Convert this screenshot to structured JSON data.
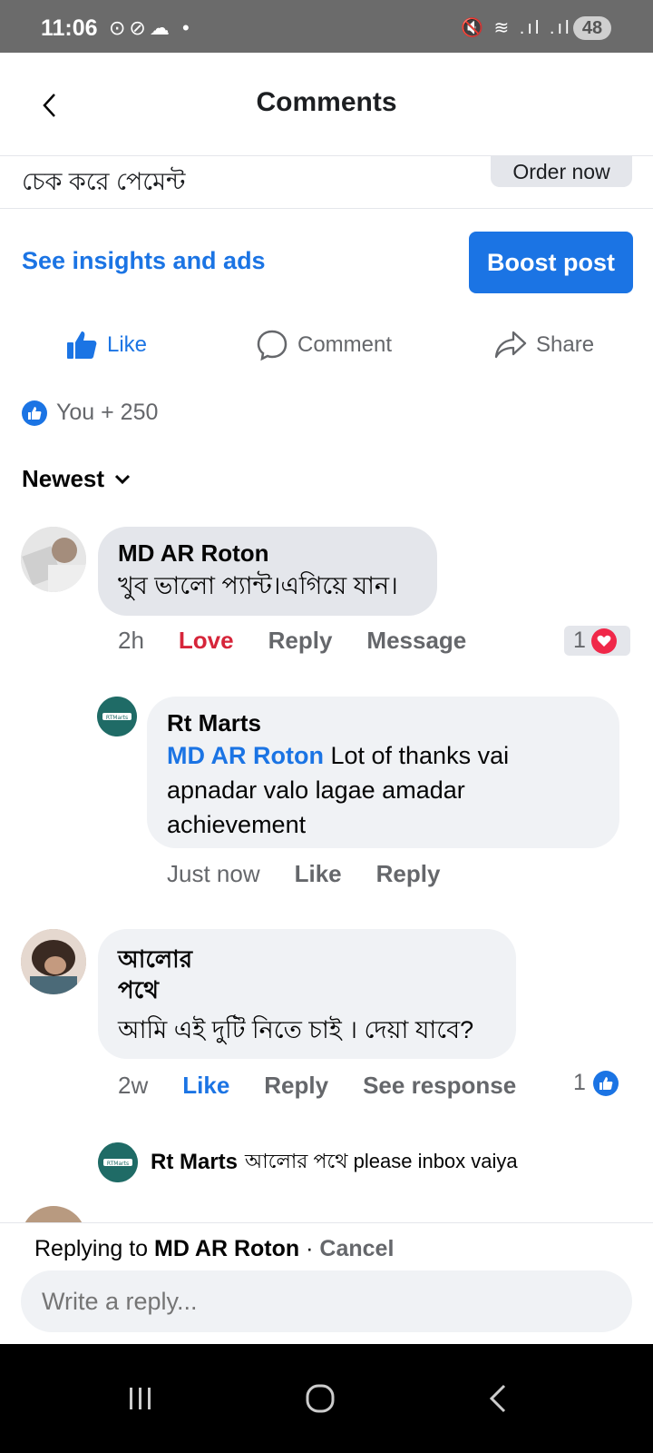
{
  "status_bar": {
    "time": "11:06",
    "left_icons": "⊙⊘☁ •",
    "right_icons": "🔇 ≋ .ıl .ıl",
    "battery": "48"
  },
  "header": {
    "title": "Comments"
  },
  "post": {
    "snippet": "চেক করে পেমেন্ট",
    "order_button": "Order now"
  },
  "insights_link": "See insights and ads",
  "boost_button": "Boost post",
  "actions": {
    "like": "Like",
    "comment": "Comment",
    "share": "Share"
  },
  "reactions_summary": "You + 250",
  "sort_label": "Newest",
  "comments": [
    {
      "author": "MD AR Roton",
      "text": "খুব ভালো প্যান্ট।এগিয়ে যান।",
      "time": "2h",
      "reaction_label": "Love",
      "reply_label": "Reply",
      "message_label": "Message",
      "reaction_count": "1",
      "reply": {
        "author": "Rt Marts",
        "mention": "MD AR Roton",
        "text": " Lot of thanks vai apnadar valo lagae amadar achievement",
        "time": "Just now",
        "like_label": "Like",
        "reply_label": "Reply"
      }
    },
    {
      "author_line1": "আলোর",
      "author_line2": "পথে",
      "text": "আমি এই দুটি নিতে চাই । দেয়া যাবে?",
      "time": "2w",
      "reaction_label": "Like",
      "reply_label": "Reply",
      "see_response_label": "See response",
      "reaction_count": "1",
      "reply": {
        "author": "Rt Marts",
        "text": "আলোর পথে please inbox vaiya"
      }
    }
  ],
  "composer": {
    "replying_prefix": "Replying to ",
    "replying_name": "MD AR Roton",
    "separator": " · ",
    "cancel_label": "Cancel",
    "placeholder": "Write a reply..."
  },
  "colors": {
    "accent": "#1b74e4",
    "love": "#d6253a",
    "bubble": "#e4e6eb"
  }
}
